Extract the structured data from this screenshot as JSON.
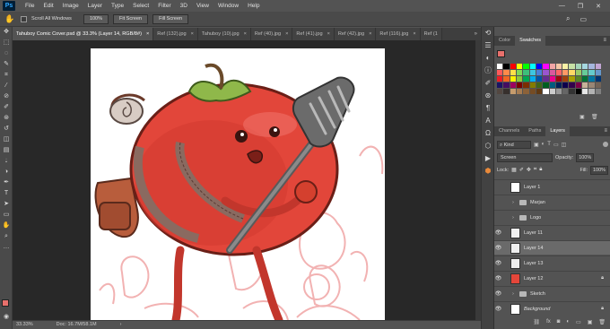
{
  "menubar": {
    "logo": "Ps",
    "items": [
      "File",
      "Edit",
      "Image",
      "Layer",
      "Type",
      "Select",
      "Filter",
      "3D",
      "View",
      "Window",
      "Help"
    ],
    "window_controls": [
      "—",
      "❐",
      "✕"
    ]
  },
  "options_bar": {
    "scroll_all_windows": "Scroll All Windows",
    "zoom_100": "100%",
    "fit_screen": "Fit Screen",
    "fill_screen": "Fill Screen"
  },
  "tabs": [
    {
      "label": "Tahuboy Comic Cover.psd @ 33.3% (Layer 14, RGB/8#)",
      "close": "×",
      "active": true
    },
    {
      "label": "Ref (132).jpg",
      "close": "×",
      "active": false
    },
    {
      "label": "Tahuboy (10).jpg",
      "close": "×",
      "active": false
    },
    {
      "label": "Ref (40).jpg",
      "close": "×",
      "active": false
    },
    {
      "label": "Ref (41).jpg",
      "close": "×",
      "active": false
    },
    {
      "label": "Ref (42).jpg",
      "close": "×",
      "active": false
    },
    {
      "label": "Ref (116).jpg",
      "close": "×",
      "active": false
    },
    {
      "label": "Ref (1",
      "close": "",
      "active": false
    }
  ],
  "tabs_more": "»",
  "statusbar": {
    "zoom": "33.33%",
    "doc": "Doc: 16.7M/58.1M"
  },
  "color_panel": {
    "tabs": [
      "Color",
      "Swatches"
    ],
    "active": "Swatches"
  },
  "swatch_colors": [
    [
      "#ffffff",
      "#000000",
      "#ff0000",
      "#ffff00",
      "#00ff00",
      "#00ffff",
      "#0000ff",
      "#ff00ff",
      "#f2a5a5",
      "#f5c6a5",
      "#f9f1a5",
      "#c7e1a5",
      "#a5d5b9",
      "#a5d7e0",
      "#a5b6de",
      "#c2a5d4"
    ],
    [
      "#ff5a5a",
      "#ff8a4a",
      "#ffe04a",
      "#7ed957",
      "#3dbf7a",
      "#3ec6e0",
      "#4a7fd9",
      "#9a55cf",
      "#d95a9e",
      "#ff6666",
      "#ff9966",
      "#ffd966",
      "#99cc66",
      "#66cc99",
      "#66cccc",
      "#6699cc"
    ],
    [
      "#ed1c24",
      "#f26522",
      "#fff200",
      "#8dc63f",
      "#00a651",
      "#00aeef",
      "#0054a6",
      "#662d91",
      "#ec008c",
      "#9e0b0f",
      "#a0410d",
      "#aba000",
      "#598527",
      "#007236",
      "#0076a3",
      "#003471"
    ],
    [
      "#1b1464",
      "#440e62",
      "#9e005d",
      "#790000",
      "#7b2e00",
      "#827b00",
      "#406618",
      "#005e20",
      "#005b7f",
      "#002157",
      "#0d004c",
      "#32004b",
      "#7b0046",
      "#c7b299",
      "#998675",
      "#736357"
    ],
    [
      "#534741",
      "#37302d",
      "#c69c6d",
      "#a67c52",
      "#8c6239",
      "#754c24",
      "#603913",
      "#ffffff",
      "#cccccc",
      "#999999",
      "#666666",
      "#333333",
      "#000000",
      "#e6e6e6",
      "#b3b3b3",
      "#808080"
    ]
  ],
  "layers_panel": {
    "tabs": [
      "Channels",
      "Paths",
      "Layers"
    ],
    "active": "Layers",
    "filter_kind": "Kind",
    "blend_mode": "Screen",
    "opacity_label": "Opacity:",
    "opacity_value": "100%",
    "lock_label": "Lock:",
    "fill_label": "Fill:",
    "fill_value": "100%",
    "layers": [
      {
        "name": "Layer 1",
        "type": "layer",
        "visible": false
      },
      {
        "name": "Marjan",
        "type": "group",
        "visible": false
      },
      {
        "name": "Logo",
        "type": "group",
        "visible": false
      },
      {
        "name": "Layer 11",
        "type": "layer",
        "visible": true
      },
      {
        "name": "Layer 14",
        "type": "layer",
        "visible": true,
        "selected": true
      },
      {
        "name": "Layer 13",
        "type": "layer",
        "visible": true
      },
      {
        "name": "Layer 12",
        "type": "layer",
        "visible": true
      },
      {
        "name": "Sketch",
        "type": "group",
        "visible": true
      },
      {
        "name": "Background",
        "type": "layer",
        "visible": true
      }
    ]
  }
}
